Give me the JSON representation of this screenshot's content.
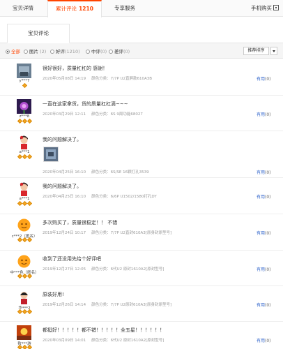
{
  "top_tabs": {
    "details": "宝贝详情",
    "reviews": "累计评论",
    "reviews_count": "1210",
    "service": "专享服务",
    "mobile": "手机购买"
  },
  "sub_tab": "宝贝评论",
  "filters": [
    {
      "label": "全部",
      "count": "",
      "selected": true
    },
    {
      "label": "图片",
      "count": "(2)",
      "selected": false
    },
    {
      "label": "好评",
      "count": "(1210)",
      "selected": false
    },
    {
      "label": "中评",
      "count": "(0)",
      "selected": false
    },
    {
      "label": "差评",
      "count": "(0)",
      "selected": false
    }
  ],
  "sort_label": "推荐排序",
  "useful_label": "有用",
  "reviews": [
    {
      "user": "y***7",
      "diamonds": 1,
      "text": "很好很好，质量杠杠的 感谢！",
      "date": "2020年05月08日 14:19",
      "sku": "颜色分类：7/7P U2直屏款610A3B",
      "count": "(0)",
      "avatar": "a1"
    },
    {
      "user": "z***8",
      "diamonds": 3,
      "text": "一直在这家拿货，货的质量杠杠滴~~~",
      "date": "2020年03月29日 12:11",
      "sku": "颜色分类：6S 9周功能68027",
      "count": "(0)",
      "avatar": "a2"
    },
    {
      "user": "a***1",
      "diamonds": 3,
      "text": "我的问题解决了。",
      "date": "2020年04月25日 16:10",
      "sku": "颜色分类：6S/SE 16颗打孔3539",
      "count": "(0)",
      "avatar": "a3",
      "thumb": true
    },
    {
      "user": "a***1",
      "diamonds": 3,
      "text": "我的问题解决了。",
      "date": "2020年04月25日 16:10",
      "sku": "颜色分类：6/6P U1502/1580打孔DY",
      "count": "(0)",
      "avatar": "a3"
    },
    {
      "user": "c***2（匿名）",
      "diamonds": 3,
      "text": "多次购买了，质量很稳定！！ 不错",
      "date": "2019年12月24日 10:17",
      "sku": "颜色分类：7/7P U2直封610A3[原身封原型号]",
      "count": "(0)",
      "avatar": "a4"
    },
    {
      "user": "中***色（匿名）",
      "diamonds": 3,
      "text": "收到了还没用先给个好评吧",
      "date": "2019年12月27日 12:05",
      "sku": "颜色分类：6代U2 原封1610A2[原封型号]",
      "count": "(0)",
      "avatar": "a4"
    },
    {
      "user": "华***2",
      "diamonds": 3,
      "text": "原装好用!",
      "date": "2019年12月26日 14:14",
      "sku": "颜色分类：7/7P U2原封610A3[原身封原型号]",
      "count": "(0)",
      "avatar": "a5"
    },
    {
      "user": "败***游",
      "diamonds": 3,
      "text": "都挺好！！！！！都不错！！！！！全五星！！！！！！",
      "date": "2020年03月09日 14:01",
      "sku": "颜色分类：6代U2 原封1610A2[原封型号]",
      "count": "(0)",
      "avatar": "a6"
    }
  ]
}
